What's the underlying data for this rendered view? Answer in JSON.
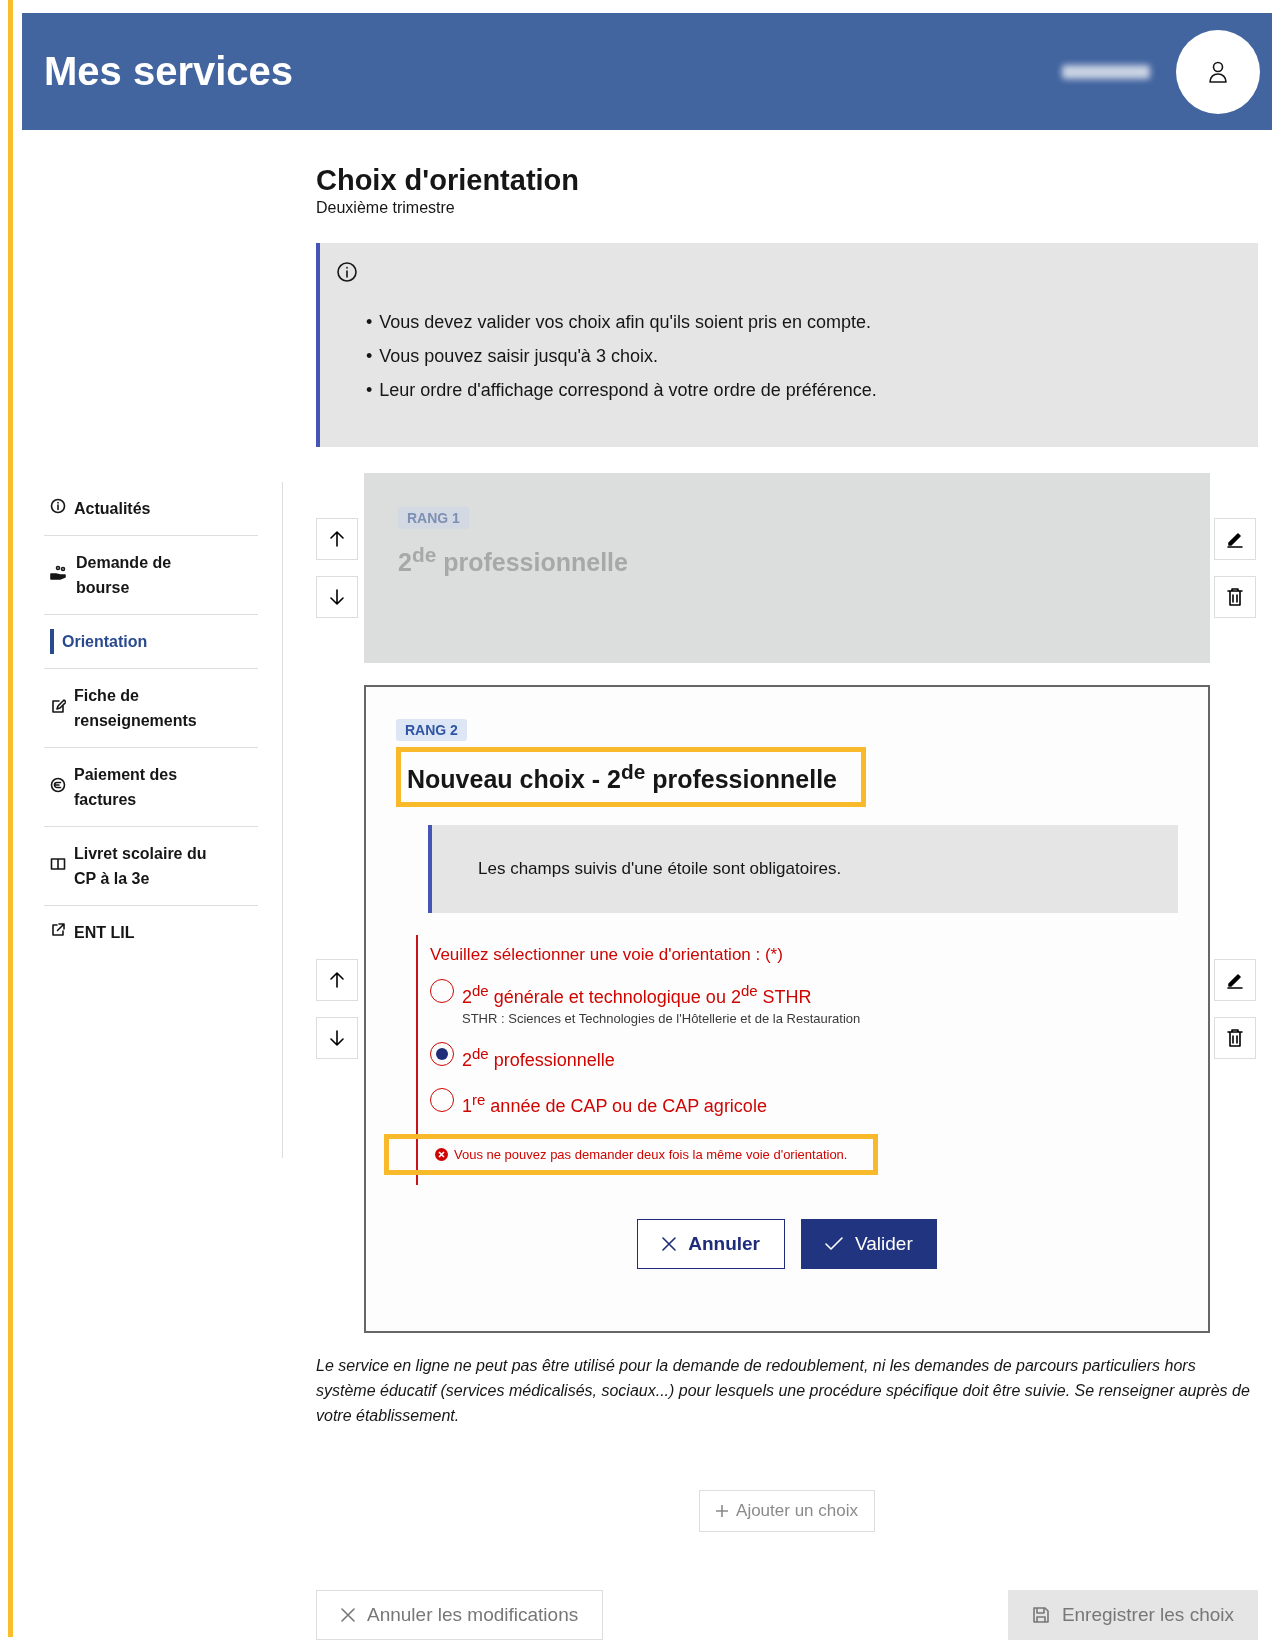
{
  "header": {
    "title": "Mes services"
  },
  "sidebar": {
    "items": [
      {
        "label": "Actualités",
        "selected": false
      },
      {
        "label": "Demande de bourse",
        "selected": false
      },
      {
        "label": "Orientation",
        "selected": true
      },
      {
        "label": "Fiche de renseignements",
        "selected": false
      },
      {
        "label": "Paiement des factures",
        "selected": false
      },
      {
        "label": "Livret scolaire du CP à la 3e",
        "selected": false
      },
      {
        "label": "ENT LIL",
        "selected": false
      }
    ]
  },
  "page": {
    "title": "Choix d'orientation",
    "subtitle": "Deuxième trimestre"
  },
  "info_box": {
    "items": [
      {
        "marker": "•",
        "text": "Vous devez valider vos choix afin qu'ils soient pris en compte."
      },
      {
        "marker": "•",
        "text": "Vous pouvez saisir jusqu'à 3 choix."
      },
      {
        "marker": "•",
        "text": "Leur ordre d'affichage correspond à votre ordre de préférence."
      }
    ]
  },
  "choices": [
    {
      "kind": "summary",
      "rank": "RANG 1",
      "title": "2$^{de}$ professionnelle",
      "disabled": true
    },
    {
      "kind": "form",
      "rank": "RANG 2",
      "title": "Nouveau choix - 2$^{de}$ professionnelle",
      "highlighted": true,
      "notice": "Les champs suivis d'une étoile sont obligatoires.",
      "question": "Veuillez sélectionner une voie d'orientation : (*)",
      "invalid": true,
      "options": [
        {
          "label": "2$^{de}$ générale et technologique ou 2$^{de}$ STHR",
          "hint": "STHR : Sciences et Technologies de l'Hôtellerie et de la Restauration",
          "selected": false
        },
        {
          "label": "2$^{de}$ professionnelle",
          "selected": true
        },
        {
          "label": "1$^{re}$ année de CAP ou de CAP agricole",
          "selected": false
        }
      ],
      "error": {
        "text": "Vous ne pouvez pas demander deux fois la même voie d'orientation.",
        "highlighted": true
      },
      "buttons": [
        {
          "label": "Annuler",
          "kind": "secondary"
        },
        {
          "label": "Valider",
          "kind": "primary"
        }
      ]
    }
  ],
  "disclaimer": "Le service en ligne ne peut pas être utilisé pour la demande de redoublement, ni les demandes de parcours particuliers hors système éducatif (services médicalisés, sociaux...) pour lesquels une procédure spécifique doit être suivie. Se renseigner auprès de votre établissement.",
  "add_button": {
    "label": "Ajouter un choix",
    "disabled": true
  },
  "footer_buttons": [
    {
      "label": "Annuler les modifications",
      "kind": "secondary",
      "disabled": true
    },
    {
      "label": "Enregistrer les choix",
      "kind": "primary",
      "disabled": true
    }
  ]
}
